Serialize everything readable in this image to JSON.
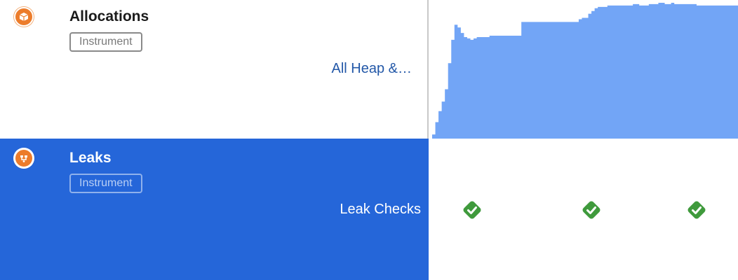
{
  "tracks": [
    {
      "title": "Allocations",
      "badge": "Instrument",
      "detail": "All Heap &…",
      "icon": "allocations-cube-icon",
      "graph_color": "#72a5f6",
      "graph_levels": [
        0.03,
        0.12,
        0.2,
        0.27,
        0.36,
        0.55,
        0.72,
        0.83,
        0.81,
        0.77,
        0.74,
        0.73,
        0.72,
        0.73,
        0.74,
        0.74,
        0.74,
        0.74,
        0.75,
        0.75,
        0.75,
        0.75,
        0.75,
        0.75,
        0.75,
        0.75,
        0.75,
        0.75,
        0.85,
        0.85,
        0.85,
        0.85,
        0.85,
        0.85,
        0.85,
        0.85,
        0.85,
        0.85,
        0.85,
        0.85,
        0.85,
        0.85,
        0.85,
        0.85,
        0.85,
        0.85,
        0.87,
        0.88,
        0.88,
        0.91,
        0.93,
        0.95,
        0.96,
        0.96,
        0.96,
        0.97,
        0.97,
        0.97,
        0.97,
        0.97,
        0.97,
        0.97,
        0.97,
        0.98,
        0.98,
        0.97,
        0.97,
        0.97,
        0.98,
        0.98,
        0.98,
        0.99,
        0.99,
        0.98,
        0.98,
        0.99,
        0.98,
        0.98,
        0.98,
        0.98,
        0.98,
        0.98,
        0.98,
        0.97,
        0.97,
        0.97,
        0.97,
        0.97,
        0.97,
        0.97,
        0.97,
        0.97,
        0.97,
        0.97,
        0.97,
        0.97
      ]
    },
    {
      "title": "Leaks",
      "badge": "Instrument",
      "detail": "Leak Checks",
      "icon": "leaks-icon",
      "selected": true,
      "checks": [
        {
          "status": "passed",
          "icon": "checkmark-diamond-icon"
        },
        {
          "status": "passed",
          "icon": "checkmark-diamond-icon"
        },
        {
          "status": "passed",
          "icon": "checkmark-diamond-icon"
        }
      ],
      "check_color": "#3f9a3c"
    }
  ]
}
